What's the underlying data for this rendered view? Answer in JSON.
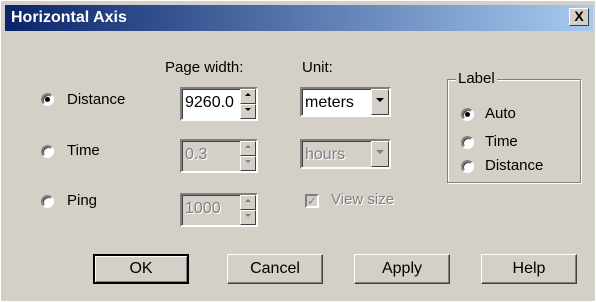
{
  "window": {
    "title": "Horizontal Axis",
    "close_label": "X"
  },
  "headers": {
    "page_width": "Page width:",
    "unit": "Unit:"
  },
  "mode": {
    "distance": {
      "label": "Distance",
      "selected": true
    },
    "time": {
      "label": "Time",
      "selected": false
    },
    "ping": {
      "label": "Ping",
      "selected": false
    }
  },
  "fields": {
    "distance_width": "9260.0",
    "time_width": "0.3",
    "ping_width": "1000"
  },
  "units": {
    "distance_unit": "meters",
    "time_unit": "hours"
  },
  "view_size": {
    "label": "View size",
    "checked": true
  },
  "label_group": {
    "title": "Label",
    "auto": "Auto",
    "time": "Time",
    "distance": "Distance",
    "selected": "Auto"
  },
  "buttons": {
    "ok": "OK",
    "cancel": "Cancel",
    "apply": "Apply",
    "help": "Help"
  }
}
